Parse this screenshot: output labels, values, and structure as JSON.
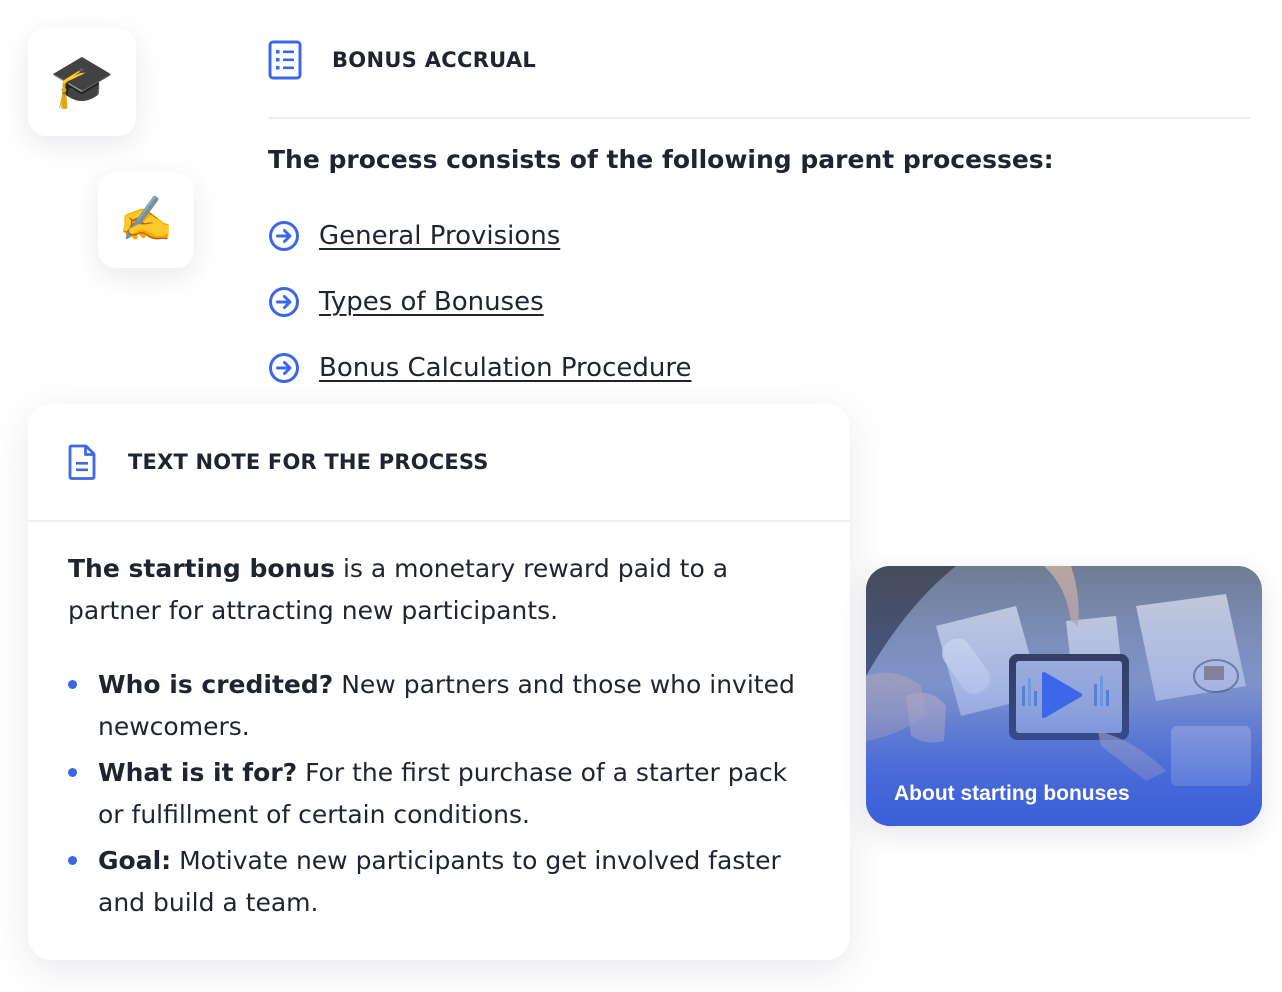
{
  "tiles": {
    "cap_emoji": "🎓",
    "pen_emoji": "✍️"
  },
  "top": {
    "title": "BONUS ACCRUAL",
    "intro": "The process consists of the following parent processes:",
    "links": [
      {
        "label": "General Provisions"
      },
      {
        "label": "Types of Bonuses"
      },
      {
        "label": "Bonus Calculation Procedure"
      }
    ]
  },
  "note": {
    "title": "TEXT NOTE FOR THE PROCESS",
    "lead_bold": "The starting bonus",
    "lead_rest": " is a monetary reward paid to a partner for attracting new participants.",
    "bullets": [
      {
        "bold": "Who is credited?",
        "text": " New partners and those who invited newcomers."
      },
      {
        "bold": "What is it for?",
        "text": " For the first purchase of a starter pack or fulfillment of certain conditions."
      },
      {
        "bold": "Goal:",
        "text": " Motivate new participants to get involved faster and build a team."
      }
    ]
  },
  "video": {
    "caption": "About starting bonuses"
  },
  "colors": {
    "accent": "#3b67e8",
    "text": "#1f2430",
    "divider": "#eceef2"
  },
  "icons": {
    "top_title_icon": "list-document-icon",
    "link_icon": "arrow-circle-right-icon",
    "note_icon": "file-text-icon",
    "video_icon": "play-icon"
  }
}
